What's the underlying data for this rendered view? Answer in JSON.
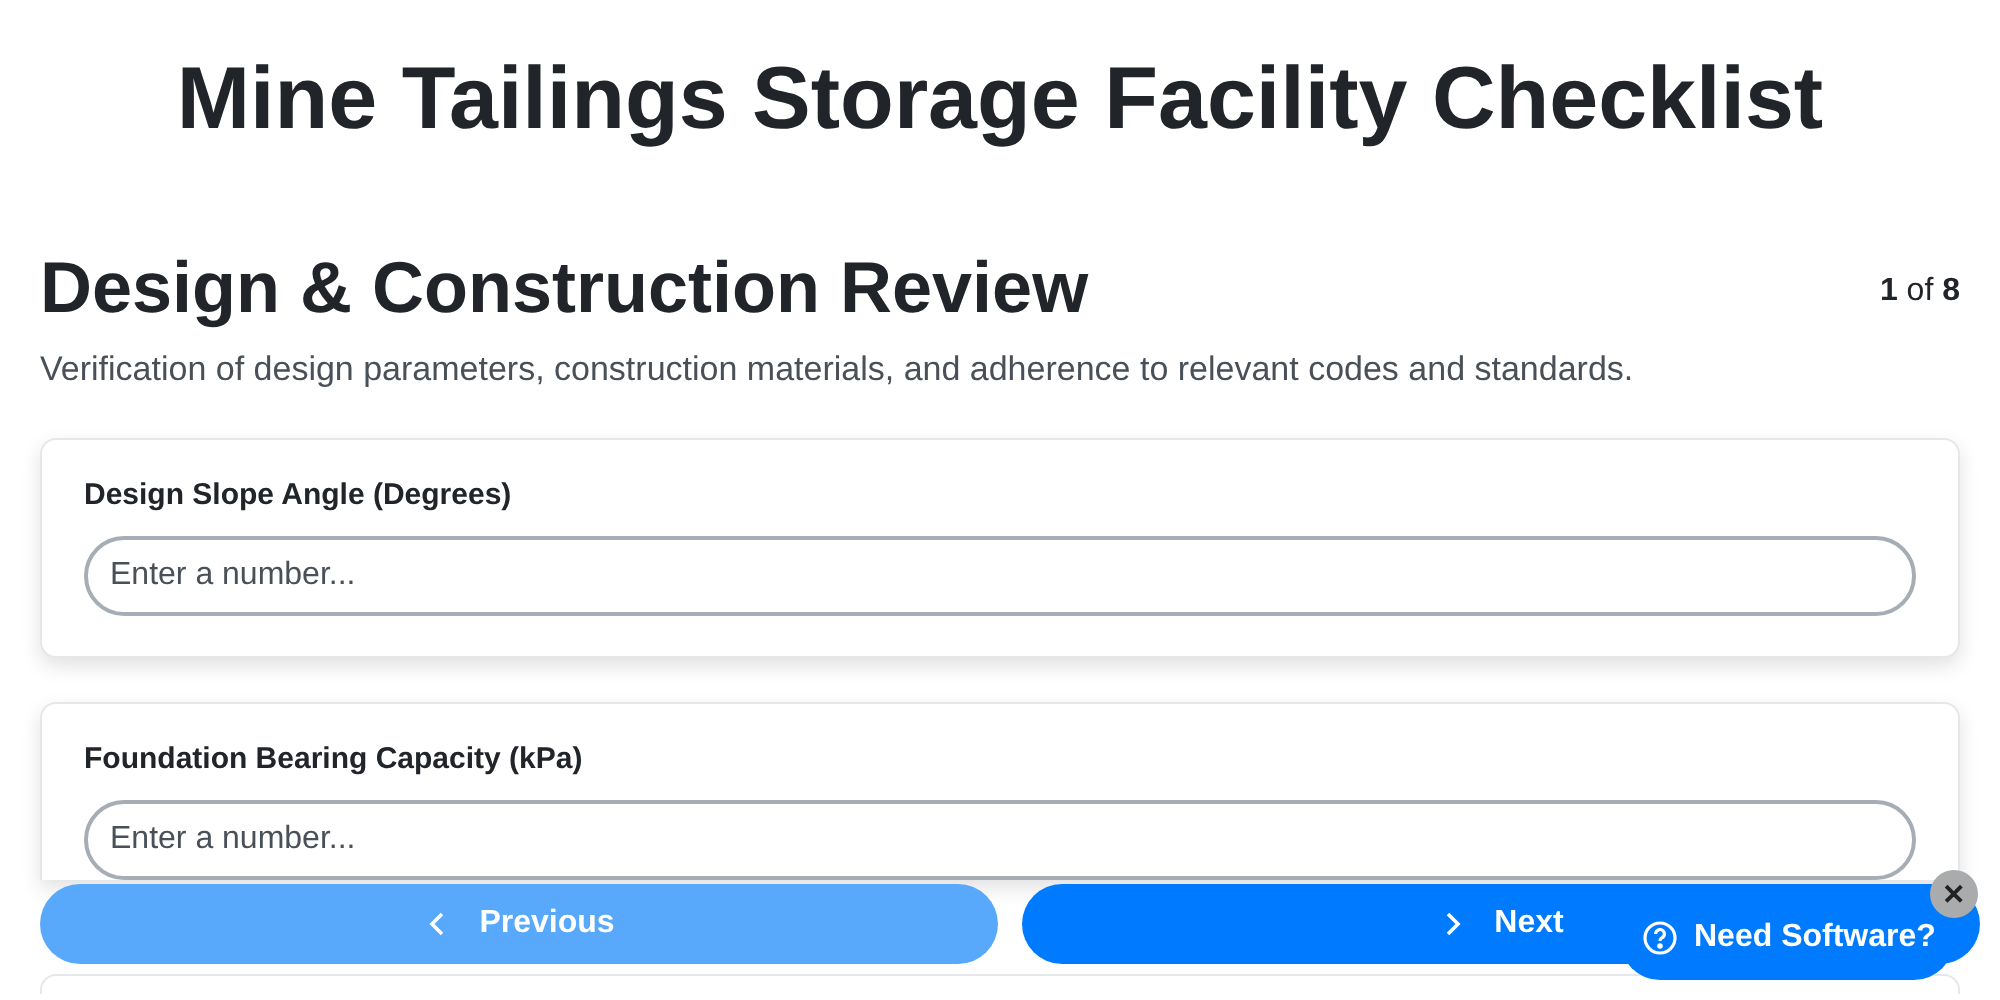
{
  "page_title": "Mine Tailings Storage Facility Checklist",
  "section": {
    "title": "Design & Construction Review",
    "progress": "**1** of **8**",
    "description": "Verification of design parameters, construction materials, and adherence to relevant codes and standards."
  },
  "fields": [
    {
      "label": "Design Slope Angle (Degrees)",
      "placeholder": "Enter a number..."
    },
    {
      "label": "Foundation Bearing Capacity (kPa)",
      "placeholder": "Enter a number..."
    }
  ],
  "navigation": [
    {
      "label": "Previous",
      "kind": "previous",
      "disabled": true
    },
    {
      "label": "Next",
      "kind": "next",
      "disabled": false
    }
  ],
  "help_badge": {
    "label": "Need Software?",
    "close": "✕"
  }
}
